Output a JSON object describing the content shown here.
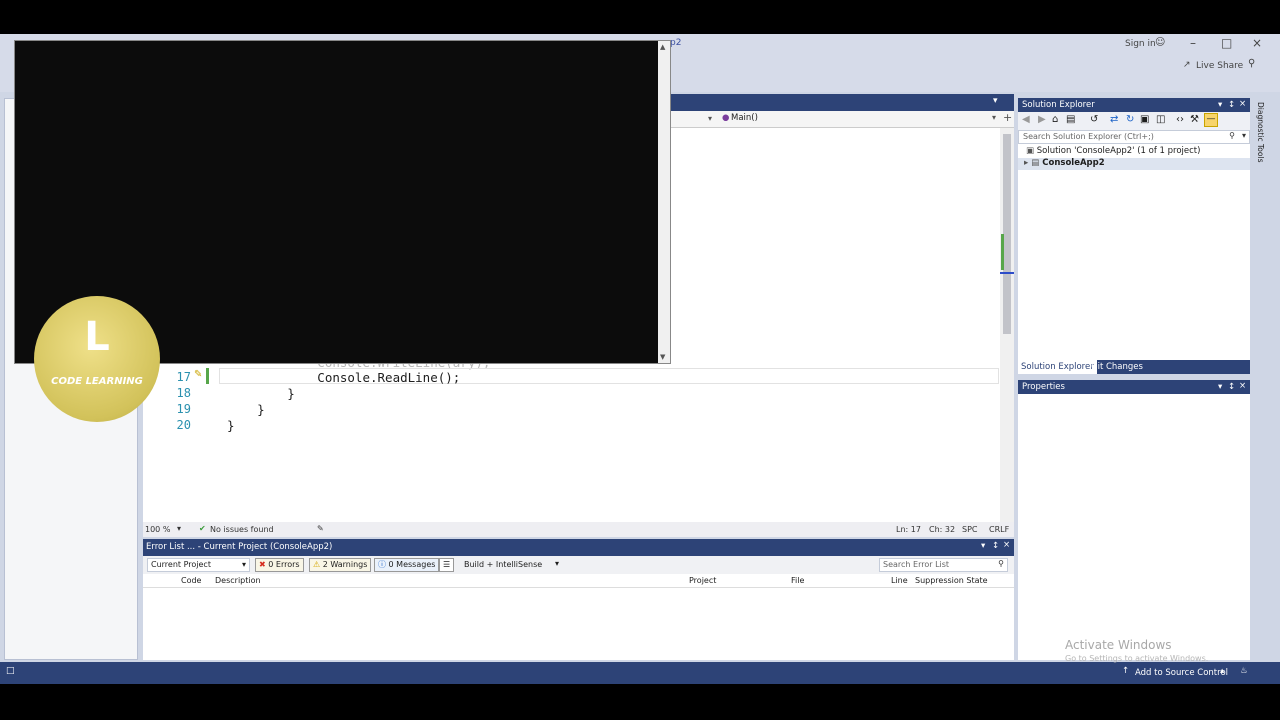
{
  "titlebar": {
    "tab_fragment": "p2",
    "sign_in": "Sign in",
    "live_share": "Live Share"
  },
  "editor": {
    "nav_member": "Main()",
    "lines": [
      {
        "num": "17",
        "text": "            Console.ReadLine();"
      },
      {
        "num": "18",
        "text": "        }"
      },
      {
        "num": "19",
        "text": "    }"
      },
      {
        "num": "20",
        "text": "}"
      }
    ],
    "partial_line": "            Console.WriteLine(ary);",
    "zoom": "100 %",
    "issues": "No issues found",
    "position": "Ln: 17",
    "column": "Ch: 32",
    "spc": "SPC",
    "eol": "CRLF"
  },
  "error_list": {
    "title": "Error List ... - Current Project (ConsoleApp2)",
    "scope": "Current Project",
    "errors": "0 Errors",
    "warnings": "2 Warnings",
    "messages": "0 Messages",
    "build_filter": "Build + IntelliSense",
    "search_placeholder": "Search Error List",
    "columns": [
      "Code",
      "Description",
      "Project",
      "File",
      "Line",
      "Suppression State"
    ]
  },
  "solution_explorer": {
    "title": "Solution Explorer",
    "search_placeholder": "Search Solution Explorer (Ctrl+;)",
    "solution_label": "Solution 'ConsoleApp2' (1 of 1 project)",
    "project_label": "ConsoleApp2",
    "tab_solution": "Solution Explorer",
    "tab_git": "Git Changes"
  },
  "properties": {
    "title": "Properties"
  },
  "diagnostic_tab": "Diagnostic Tools",
  "status_bar": {
    "add_source": "Add to Source Control"
  },
  "watermark": {
    "line1": "Activate Windows",
    "line2": "Go to Settings to activate Windows."
  },
  "logo": {
    "text": "CODE LEARNING",
    "letter": "L"
  },
  "colors": {
    "accent": "#2d4377",
    "linenum": "#2b91af",
    "console_bg": "#0c0c0c"
  }
}
